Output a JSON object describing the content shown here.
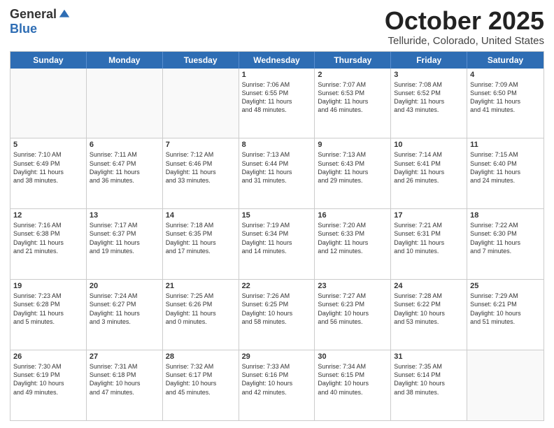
{
  "logo": {
    "general": "General",
    "blue": "Blue"
  },
  "header": {
    "month": "October 2025",
    "location": "Telluride, Colorado, United States"
  },
  "weekdays": [
    "Sunday",
    "Monday",
    "Tuesday",
    "Wednesday",
    "Thursday",
    "Friday",
    "Saturday"
  ],
  "rows": [
    [
      {
        "day": "",
        "info": "",
        "empty": true
      },
      {
        "day": "",
        "info": "",
        "empty": true
      },
      {
        "day": "",
        "info": "",
        "empty": true
      },
      {
        "day": "1",
        "info": "Sunrise: 7:06 AM\nSunset: 6:55 PM\nDaylight: 11 hours\nand 48 minutes."
      },
      {
        "day": "2",
        "info": "Sunrise: 7:07 AM\nSunset: 6:53 PM\nDaylight: 11 hours\nand 46 minutes."
      },
      {
        "day": "3",
        "info": "Sunrise: 7:08 AM\nSunset: 6:52 PM\nDaylight: 11 hours\nand 43 minutes."
      },
      {
        "day": "4",
        "info": "Sunrise: 7:09 AM\nSunset: 6:50 PM\nDaylight: 11 hours\nand 41 minutes."
      }
    ],
    [
      {
        "day": "5",
        "info": "Sunrise: 7:10 AM\nSunset: 6:49 PM\nDaylight: 11 hours\nand 38 minutes."
      },
      {
        "day": "6",
        "info": "Sunrise: 7:11 AM\nSunset: 6:47 PM\nDaylight: 11 hours\nand 36 minutes."
      },
      {
        "day": "7",
        "info": "Sunrise: 7:12 AM\nSunset: 6:46 PM\nDaylight: 11 hours\nand 33 minutes."
      },
      {
        "day": "8",
        "info": "Sunrise: 7:13 AM\nSunset: 6:44 PM\nDaylight: 11 hours\nand 31 minutes."
      },
      {
        "day": "9",
        "info": "Sunrise: 7:13 AM\nSunset: 6:43 PM\nDaylight: 11 hours\nand 29 minutes."
      },
      {
        "day": "10",
        "info": "Sunrise: 7:14 AM\nSunset: 6:41 PM\nDaylight: 11 hours\nand 26 minutes."
      },
      {
        "day": "11",
        "info": "Sunrise: 7:15 AM\nSunset: 6:40 PM\nDaylight: 11 hours\nand 24 minutes."
      }
    ],
    [
      {
        "day": "12",
        "info": "Sunrise: 7:16 AM\nSunset: 6:38 PM\nDaylight: 11 hours\nand 21 minutes."
      },
      {
        "day": "13",
        "info": "Sunrise: 7:17 AM\nSunset: 6:37 PM\nDaylight: 11 hours\nand 19 minutes."
      },
      {
        "day": "14",
        "info": "Sunrise: 7:18 AM\nSunset: 6:35 PM\nDaylight: 11 hours\nand 17 minutes."
      },
      {
        "day": "15",
        "info": "Sunrise: 7:19 AM\nSunset: 6:34 PM\nDaylight: 11 hours\nand 14 minutes."
      },
      {
        "day": "16",
        "info": "Sunrise: 7:20 AM\nSunset: 6:33 PM\nDaylight: 11 hours\nand 12 minutes."
      },
      {
        "day": "17",
        "info": "Sunrise: 7:21 AM\nSunset: 6:31 PM\nDaylight: 11 hours\nand 10 minutes."
      },
      {
        "day": "18",
        "info": "Sunrise: 7:22 AM\nSunset: 6:30 PM\nDaylight: 11 hours\nand 7 minutes."
      }
    ],
    [
      {
        "day": "19",
        "info": "Sunrise: 7:23 AM\nSunset: 6:28 PM\nDaylight: 11 hours\nand 5 minutes."
      },
      {
        "day": "20",
        "info": "Sunrise: 7:24 AM\nSunset: 6:27 PM\nDaylight: 11 hours\nand 3 minutes."
      },
      {
        "day": "21",
        "info": "Sunrise: 7:25 AM\nSunset: 6:26 PM\nDaylight: 11 hours\nand 0 minutes."
      },
      {
        "day": "22",
        "info": "Sunrise: 7:26 AM\nSunset: 6:25 PM\nDaylight: 10 hours\nand 58 minutes."
      },
      {
        "day": "23",
        "info": "Sunrise: 7:27 AM\nSunset: 6:23 PM\nDaylight: 10 hours\nand 56 minutes."
      },
      {
        "day": "24",
        "info": "Sunrise: 7:28 AM\nSunset: 6:22 PM\nDaylight: 10 hours\nand 53 minutes."
      },
      {
        "day": "25",
        "info": "Sunrise: 7:29 AM\nSunset: 6:21 PM\nDaylight: 10 hours\nand 51 minutes."
      }
    ],
    [
      {
        "day": "26",
        "info": "Sunrise: 7:30 AM\nSunset: 6:19 PM\nDaylight: 10 hours\nand 49 minutes."
      },
      {
        "day": "27",
        "info": "Sunrise: 7:31 AM\nSunset: 6:18 PM\nDaylight: 10 hours\nand 47 minutes."
      },
      {
        "day": "28",
        "info": "Sunrise: 7:32 AM\nSunset: 6:17 PM\nDaylight: 10 hours\nand 45 minutes."
      },
      {
        "day": "29",
        "info": "Sunrise: 7:33 AM\nSunset: 6:16 PM\nDaylight: 10 hours\nand 42 minutes."
      },
      {
        "day": "30",
        "info": "Sunrise: 7:34 AM\nSunset: 6:15 PM\nDaylight: 10 hours\nand 40 minutes."
      },
      {
        "day": "31",
        "info": "Sunrise: 7:35 AM\nSunset: 6:14 PM\nDaylight: 10 hours\nand 38 minutes."
      },
      {
        "day": "",
        "info": "",
        "empty": true
      }
    ]
  ]
}
